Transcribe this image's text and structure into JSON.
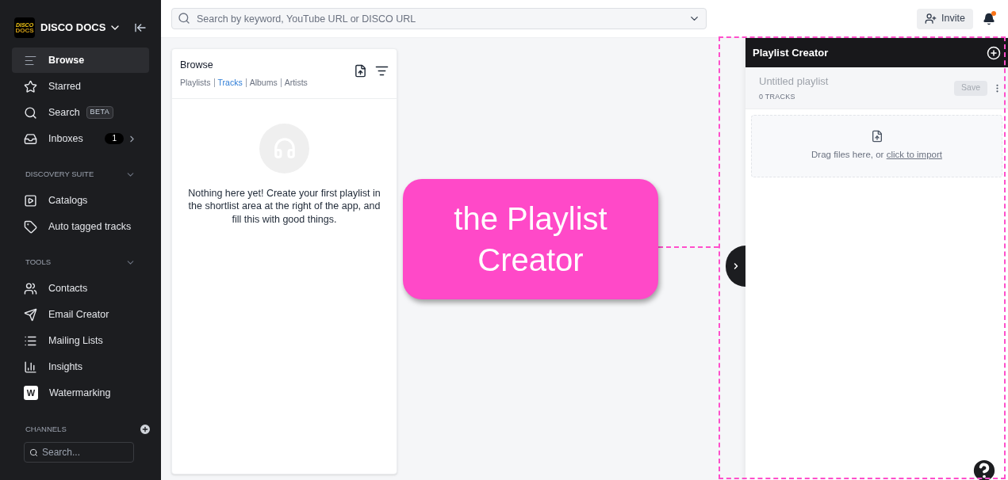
{
  "sidebar": {
    "logo": {
      "line_1": "DISCO",
      "line_2": "DOCS"
    },
    "workspace": "DISCO DOCS",
    "items": [
      {
        "label": "Browse",
        "selected": true
      },
      {
        "label": "Starred",
        "selected": false
      },
      {
        "label": "Search",
        "selected": false,
        "badge": "BETA"
      },
      {
        "label": "Inboxes",
        "selected": false,
        "count": "1"
      }
    ],
    "sections": [
      {
        "title": "DISCOVERY SUITE",
        "expanded": true,
        "items": [
          {
            "label": "Catalogs",
            "selected": false
          },
          {
            "label": "Auto tagged tracks",
            "selected": false
          }
        ]
      },
      {
        "title": "TOOLS",
        "expanded": true,
        "items": [
          {
            "label": "Contacts",
            "selected": false
          },
          {
            "label": "Email Creator",
            "selected": false
          },
          {
            "label": "Mailing Lists",
            "selected": false
          },
          {
            "label": "Insights",
            "selected": false
          },
          {
            "label": "Watermarking",
            "selected": false,
            "mark": "W"
          }
        ]
      }
    ],
    "channels": {
      "title": "CHANNELS",
      "search": {
        "placeholder": "Search..."
      }
    }
  },
  "topbar": {
    "search": {
      "placeholder": "Search by keyword, YouTube URL or DISCO URL"
    },
    "invite": "Invite",
    "notification": true
  },
  "browse": {
    "title": "Browse",
    "tabs": [
      {
        "label": "Playlists",
        "selected": false
      },
      {
        "label": "Tracks",
        "selected": true
      },
      {
        "label": "Albums",
        "selected": false
      },
      {
        "label": "Artists",
        "selected": false
      }
    ],
    "empty_message": "Nothing here yet! Create your first playlist in the shortlist area at the right of the app, and fill this with good things."
  },
  "playlist_creator": {
    "title": "Playlist Creator",
    "name": {
      "placeholder": "Untitled playlist"
    },
    "tracks": "0 TRACKS",
    "save": {
      "label": "Save",
      "disabled": true
    },
    "dropzone": {
      "text": "Drag files here, or ",
      "link": "click to import"
    }
  },
  "annotation": {
    "text": "the Playlist Creator"
  }
}
